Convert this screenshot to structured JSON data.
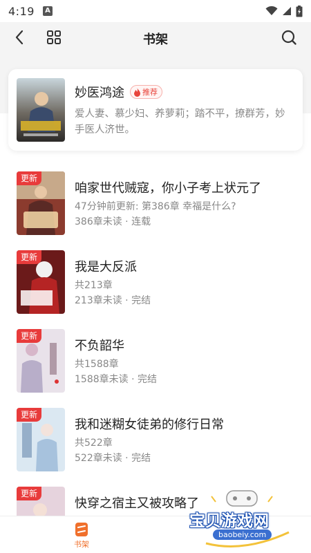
{
  "status_bar": {
    "time": "4:19",
    "notification_badge": "A"
  },
  "nav": {
    "title": "书架"
  },
  "recommended": {
    "title": "妙医鸿途",
    "badge": "推荐",
    "description": "爱人妻、慕少妇、养萝莉；踏不平，撩群芳，妙手医人济世。"
  },
  "books": [
    {
      "tag": "更新",
      "title": "咱家世代贼寇，你小子考上状元了",
      "line1": "47分钟前更新: 第386章 幸福是什么?",
      "line2": "386章未读 · 连载",
      "cover_color": "#8b3b2e"
    },
    {
      "tag": "更新",
      "title": "我是大反派",
      "line1": "共213章",
      "line2": "213章未读 · 完结",
      "cover_color": "#6b1a1a"
    },
    {
      "tag": "更新",
      "title": "不负韶华",
      "line1": "共1588章",
      "line2": "1588章未读 · 完结",
      "cover_color": "#e9e2ea"
    },
    {
      "tag": "更新",
      "title": "我和迷糊女徒弟的修行日常",
      "line1": "共522章",
      "line2": "522章未读 · 完结",
      "cover_color": "#dbe8f2"
    },
    {
      "tag": "更新",
      "title": "快穿之宿主又被攻略了",
      "line1": "",
      "line2": "",
      "cover_color": "#e6d3dd"
    }
  ],
  "tab_bar": {
    "shelf_label": "书架"
  },
  "watermark": {
    "text": "宝贝游戏网",
    "url": "baobeiy.com"
  },
  "colors": {
    "accent": "#f0702c",
    "update_tag": "#e83b3b",
    "badge_red": "#e8453c"
  },
  "icons": [
    "back-icon",
    "grid-icon",
    "search-icon",
    "wifi-icon",
    "signal-icon",
    "battery-icon",
    "fire-icon",
    "bookshelf-icon"
  ]
}
